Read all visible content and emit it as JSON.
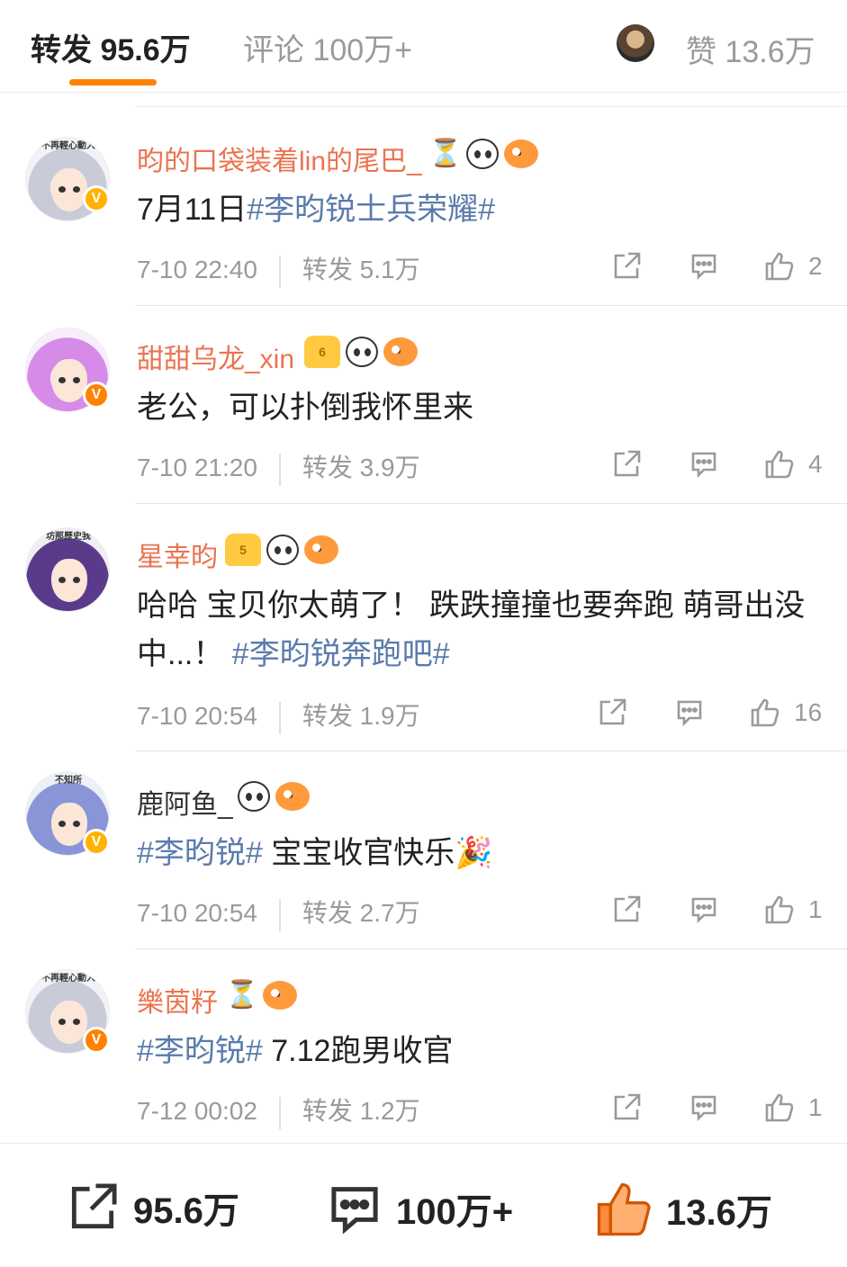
{
  "header": {
    "forward_tab": "转发 95.6万",
    "comment_tab": "评论 100万+",
    "like_tab": "赞 13.6万"
  },
  "comments": [
    {
      "avatar_caption": "不再輕心動人",
      "username": "昀的口袋装着lin的尾巴_",
      "username_color": "#eb7350",
      "badges": [
        "hourglass",
        "panda",
        "fish"
      ],
      "text_plain": "7月11日",
      "tag": "#李昀锐士兵荣耀#",
      "time": "7-10 22:40",
      "reposts": "转发 5.1万",
      "likes": "2"
    },
    {
      "avatar_caption": "",
      "username": "甜甜乌龙_xin",
      "username_color": "#eb7350",
      "badges": [
        "crown",
        "panda",
        "fish"
      ],
      "text_plain": "老公，可以扑倒我怀里来",
      "tag": "",
      "time": "7-10 21:20",
      "reposts": "转发 3.9万",
      "likes": "4"
    },
    {
      "avatar_caption": "坊那歷史我",
      "username": "星幸昀",
      "username_color": "#eb7350",
      "badges": [
        "crown",
        "panda",
        "fish"
      ],
      "text_line1": "哈哈 宝贝你太萌了！ 跌跌撞撞也要奔跑 萌哥出没",
      "text_line2_plain": "中...！ ",
      "tag": "#李昀锐奔跑吧#",
      "time": "7-10 20:54",
      "reposts": "转发 1.9万",
      "likes": "16"
    },
    {
      "avatar_caption": "不知所",
      "username": "鹿阿鱼_",
      "username_color": "#333333",
      "badges": [
        "panda",
        "fish"
      ],
      "tag": "#李昀锐#",
      "text_plain": " 宝宝收官快乐🎉",
      "time": "7-10 20:54",
      "reposts": "转发 2.7万",
      "likes": "1"
    },
    {
      "avatar_caption": "不再輕心動人",
      "username": "樂茵籽",
      "username_color": "#eb7350",
      "badges": [
        "hourglass",
        "fish"
      ],
      "tag": "#李昀锐#",
      "text_plain": " 7.12跑男收官",
      "time": "7-12 00:02",
      "reposts": "转发 1.2万",
      "likes": "1"
    }
  ],
  "bottom_bar": {
    "forward_count": "95.6万",
    "comment_count": "100万+",
    "like_count": "13.6万"
  },
  "colors": {
    "accent": "#ff8200",
    "username": "#eb7350",
    "topic": "#5a7bab",
    "muted": "#9a9a9a"
  }
}
